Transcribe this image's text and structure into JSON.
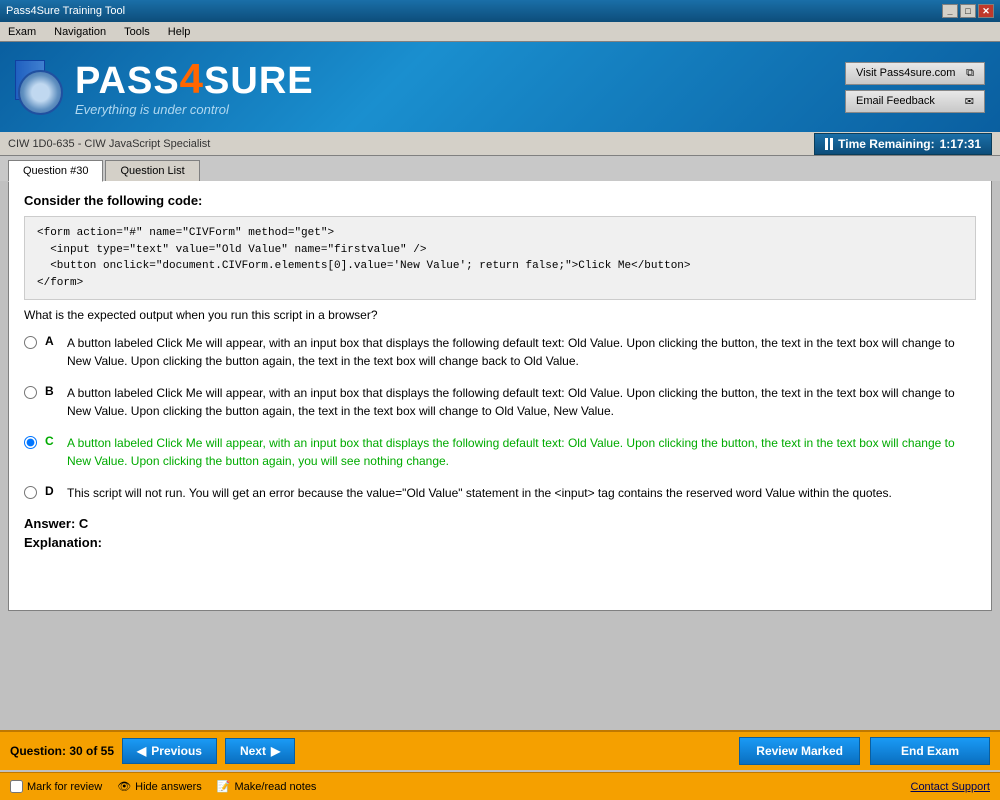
{
  "titleBar": {
    "title": "Pass4Sure Training Tool",
    "controls": [
      "_",
      "□",
      "✕"
    ]
  },
  "menuBar": {
    "items": [
      "Exam",
      "Navigation",
      "Tools",
      "Help"
    ]
  },
  "header": {
    "logoText": "PASS",
    "logoFour": "4",
    "logoSure": "SURE",
    "tagline": "Everything is under control",
    "visitButton": "Visit Pass4sure.com",
    "emailButton": "Email Feedback"
  },
  "infoBar": {
    "breadcrumb": "CIW 1D0-635 - CIW JavaScript Specialist",
    "timerLabel": "Time Remaining:",
    "timerValue": "1:17:31"
  },
  "tabs": [
    {
      "label": "Question #30",
      "active": true
    },
    {
      "label": "Question List",
      "active": false
    }
  ],
  "question": {
    "header": "Consider the following code:",
    "code": "<form action=\"#\" name=\"CIVForm\" method=\"get\">\n  <input type=\"text\" value=\"Old Value\" name=\"firstvalue\" />\n  <button onclick=\"document.CIVForm.elements[0].value='New Value'; return false;\">Click Me</button>\n</form>",
    "text": "What is the expected output when you run this script in a browser?",
    "options": [
      {
        "letter": "A",
        "text": "A button labeled Click Me will appear, with an input box that displays the following default text: Old Value. Upon clicking the button, the text in the text box will change to New Value. Upon clicking the button again, the text in the text box will change back to Old Value.",
        "correct": false
      },
      {
        "letter": "B",
        "text": "A button labeled Click Me will appear, with an input box that displays the following default text: Old Value. Upon clicking the button, the text in the text box will change to New Value. Upon clicking the button again, the text in the text box will change to Old Value, New Value.",
        "correct": false
      },
      {
        "letter": "C",
        "text": "A button labeled Click Me will appear, with an input box that displays the following default text: Old Value. Upon clicking the button, the text in the text box will change to New Value. Upon clicking the button again, you will see nothing change.",
        "correct": true
      },
      {
        "letter": "D",
        "text": "This script will not run. You will get an error because the value=\"Old Value\" statement in the <input> tag contains the reserved word Value within the quotes.",
        "correct": false
      }
    ],
    "answer": "Answer: C",
    "explanation": "Explanation:"
  },
  "bottomBar": {
    "questionCount": "Question: 30 of 55",
    "previousLabel": "Previous",
    "nextLabel": "Next",
    "reviewMarkedLabel": "Review Marked",
    "endExamLabel": "End Exam"
  },
  "footerBar": {
    "markForReview": "Mark for review",
    "hideAnswers": "Hide answers",
    "makeReadNotes": "Make/read notes",
    "contactSupport": "Contact Support"
  }
}
